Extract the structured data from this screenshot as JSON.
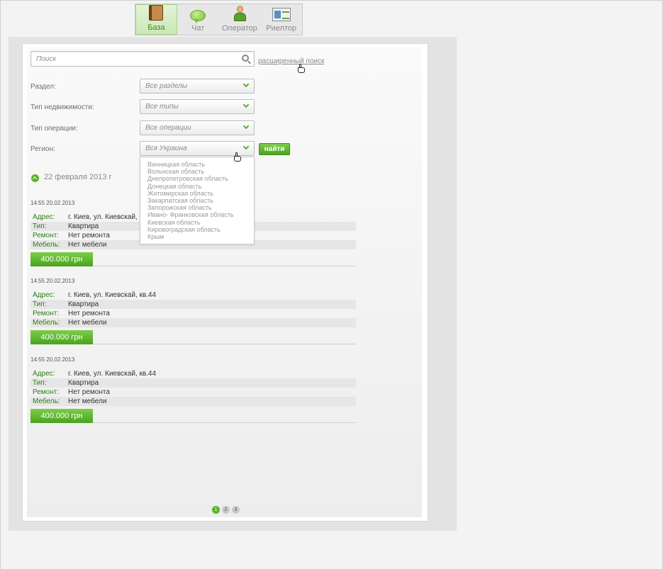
{
  "tabs": [
    {
      "id": "base",
      "label": "База",
      "icon": "book-icon",
      "active": true
    },
    {
      "id": "chat",
      "label": "Чат",
      "icon": "chat-icon",
      "active": false
    },
    {
      "id": "operator",
      "label": "Оператор",
      "icon": "operator-icon",
      "active": false
    },
    {
      "id": "realtor",
      "label": "Риелтор",
      "icon": "id-card-icon",
      "active": false
    }
  ],
  "search": {
    "placeholder": "Поиск",
    "advanced_link": "расширенный поиск"
  },
  "filters": {
    "section": {
      "label": "Раздел:",
      "value": "Все разделы"
    },
    "property_type": {
      "label": "Тип недвижимости:",
      "value": "Все типы"
    },
    "operation_type": {
      "label": "Тип операции:",
      "value": "Все операции"
    },
    "region": {
      "label": "Регион:",
      "value": "Вся Украина"
    },
    "find_button": "найти"
  },
  "region_options": [
    "Винницкая область",
    "Вольнская область",
    "Днепропетровская область",
    "Донецкая область",
    "Житомирская область",
    "Закарпатская область",
    "Запорожская область",
    "Ивано- Франковская область",
    "Киевская область",
    "Кировоградская область",
    "Крым"
  ],
  "date_header": "22 февраля 2013 г",
  "listings": [
    {
      "time": "14:55  20.02.2013",
      "address_label": "Адрес:",
      "address": "г. Киев, ул. Киевскай, к",
      "type_label": "Тип:",
      "type": "Квартира",
      "repair_label": "Ремонт:",
      "repair": "Нет ремонта",
      "furniture_label": "Мебель:",
      "furniture": "Нет мебели",
      "price": "400.000 грн"
    },
    {
      "time": "14:55  20.02.2013",
      "address_label": "Адрес:",
      "address": "г. Киев, ул. Киевскай, кв.44",
      "type_label": "Тип:",
      "type": "Квартира",
      "repair_label": "Ремонт:",
      "repair": "Нет ремонта",
      "furniture_label": "Мебель:",
      "furniture": "Нет мебели",
      "price": "400.000 грн"
    },
    {
      "time": "14:55  20.02.2013",
      "address_label": "Адрес:",
      "address": "г. Киев, ул. Киевскай, кв.44",
      "type_label": "Тип:",
      "type": "Квартира",
      "repair_label": "Ремонт:",
      "repair": "Нет ремонта",
      "furniture_label": "Мебель:",
      "furniture": "Нет мебели",
      "price": "400.000 грн"
    }
  ],
  "pagination": {
    "pages": [
      "1",
      "2",
      "3"
    ],
    "current": "1"
  },
  "colors": {
    "accent": "#5cb32d",
    "label_green": "#2a7d12"
  }
}
